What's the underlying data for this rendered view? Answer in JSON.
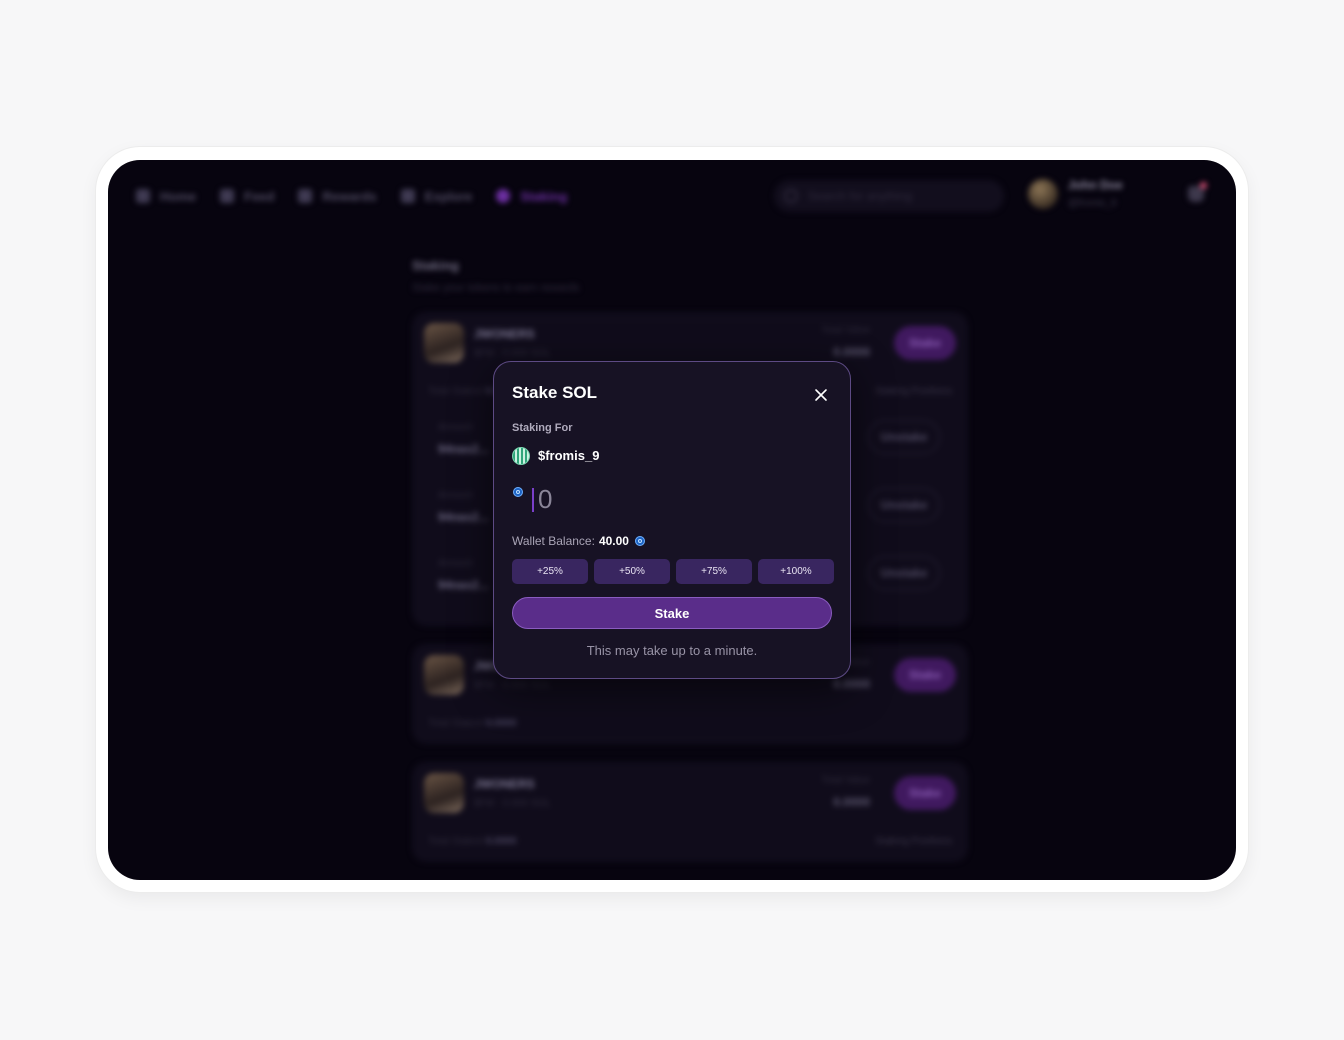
{
  "nav": {
    "items": [
      {
        "label": "Home",
        "icon": "home-icon"
      },
      {
        "label": "Feed",
        "icon": "feed-icon"
      },
      {
        "label": "Rewards",
        "icon": "rewards-icon"
      },
      {
        "label": "Explore",
        "icon": "explore-icon"
      },
      {
        "label": "Staking",
        "icon": "staking-icon",
        "active": true
      }
    ]
  },
  "search": {
    "placeholder": "Search for anything"
  },
  "user": {
    "name": "John Doe",
    "handle": "@fromis_9"
  },
  "page": {
    "title": "Staking",
    "subtitle": "Stake your tokens to earn rewards"
  },
  "cards": [
    {
      "name": "JWONERS",
      "meta": "$FM · 0.000 SOL",
      "total_value_label": "Total Value",
      "total_value": "0.0000",
      "stake_label": "Stake",
      "footer_left_label": "Total Staked",
      "footer_left_value": "0.0000",
      "footer_right": "Staking Positions",
      "positions": [
        {
          "label": "Amount",
          "value": "94nas2...",
          "action": "Unstake"
        },
        {
          "label": "Amount",
          "value": "94nas2...",
          "action": "Unstake"
        },
        {
          "label": "Amount",
          "value": "94nas2...",
          "action": "Unstake"
        }
      ]
    },
    {
      "name": "JWONERS",
      "meta": "$FM · 0.000 SOL",
      "total_value_label": "Total Value",
      "total_value": "0.0000",
      "stake_label": "Stake",
      "footer_left_label": "Total Staked",
      "footer_left_value": "0.0000",
      "footer_right": ""
    },
    {
      "name": "JWONERS",
      "meta": "$FM · 0.000 SOL",
      "total_value_label": "Total Value",
      "total_value": "0.0000",
      "stake_label": "Stake",
      "footer_left_label": "Total Staked",
      "footer_left_value": "0.0000",
      "footer_right": "Staking Positions"
    }
  ],
  "modal": {
    "title": "Stake SOL",
    "staking_for_label": "Staking For",
    "token_name": "$fromis_9",
    "amount_placeholder": "0",
    "wallet_balance_label": "Wallet Balance:",
    "wallet_balance_value": "40.00",
    "percent_buttons": [
      "+25%",
      "+50%",
      "+75%",
      "+100%"
    ],
    "stake_button": "Stake",
    "note": "This may take up to a minute."
  },
  "colors": {
    "background": "#07040f",
    "modal_bg": "#171224",
    "accent": "#5a2d8a",
    "chip": "#392660",
    "coin": "#1d63c4"
  }
}
